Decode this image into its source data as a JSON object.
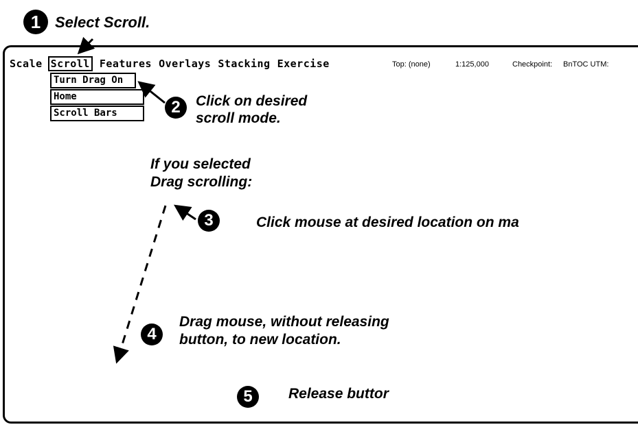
{
  "steps": {
    "s1": {
      "number": "1",
      "text": "Select Scroll."
    },
    "s2": {
      "number": "2",
      "line1": "Click on desired",
      "line2": "scroll mode."
    },
    "intro": {
      "line1": "If you selected",
      "line2": "Drag scrolling:"
    },
    "s3": {
      "number": "3",
      "text": "Click mouse at desired location on ma"
    },
    "s4": {
      "number": "4",
      "line1": "Drag mouse, without releasing",
      "line2": "button, to new location."
    },
    "s5": {
      "number": "5",
      "text": "Release buttor"
    }
  },
  "menubar": {
    "items": [
      "Scale",
      "Scroll",
      "Features",
      "Overlays",
      "Stacking",
      "Exercise"
    ],
    "active": "Scroll"
  },
  "status": {
    "top": "Top: (none)",
    "scale": "1:125,000",
    "checkpoint": "Checkpoint:",
    "coord": "BnTOC UTM:"
  },
  "dropdown": {
    "items": [
      "Turn Drag On",
      "Home",
      "Scroll Bars"
    ]
  }
}
